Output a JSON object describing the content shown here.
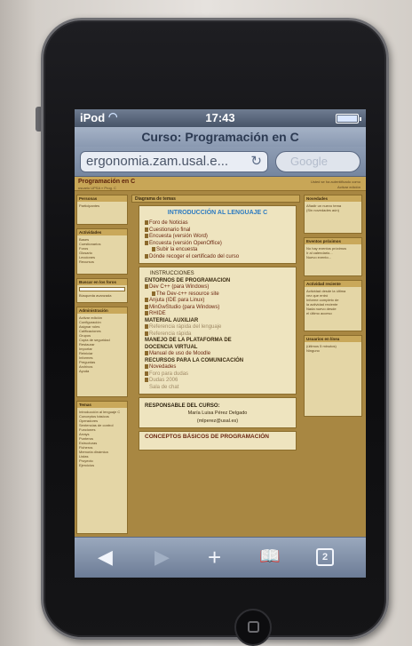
{
  "status": {
    "carrier": "iPod",
    "time": "17:43"
  },
  "browser": {
    "title": "Curso: Programación en C",
    "url": "ergonomia.zam.usal.e...",
    "search_placeholder": "Google"
  },
  "site": {
    "title": "Programación en C",
    "crumb": "usuario UPSA » Prog. C",
    "login": "Usted se ha autentificado como",
    "tools": "Activar edición"
  },
  "left_blocks": [
    {
      "heading": "Personas",
      "lines": [
        "Participantes"
      ]
    },
    {
      "heading": "Actividades",
      "lines": [
        "Bases",
        "Cuestionarios",
        "Foros",
        "Glosario",
        "Lecciones",
        "Recursos"
      ]
    },
    {
      "heading": "Buscar en los foros",
      "lines": [
        "Búsqueda avanzada"
      ]
    },
    {
      "heading": "Administración",
      "lines": [
        "Activar edición",
        "Configuración",
        "Asignar roles",
        "Calificaciones",
        "Grupos",
        "Copia de seguridad",
        "Restaurar",
        "Importar",
        "Reiniciar",
        "Informes",
        "Preguntas",
        "Archivos",
        "Ayuda"
      ]
    },
    {
      "heading": "Temas",
      "lines": [
        "Introducción al lenguaje C",
        "Conceptos básicos",
        "Operadores",
        "Sentencias de control",
        "Funciones",
        "Arrays",
        "Punteros",
        "Estructuras",
        "Ficheros",
        "Memoria dinámica",
        "Listas",
        "Proyecto",
        "Ejercicios"
      ]
    }
  ],
  "right_blocks": [
    {
      "heading": "Novedades",
      "lines": [
        "Añadir un nuevo tema",
        "(Sin novedades aún)"
      ]
    },
    {
      "heading": "Eventos próximos",
      "lines": [
        "No hay eventos próximos",
        "Ir al calendario...",
        "Nuevo evento..."
      ]
    },
    {
      "heading": "Actividad reciente",
      "lines": [
        "Actividad desde la última",
        "vez que entró",
        "Informe completo de",
        "la actividad reciente",
        "Nada nuevo desde",
        "el último acceso"
      ]
    },
    {
      "heading": "Usuarios en línea",
      "lines": [
        "(últimos 5 minutos)",
        "Ninguno"
      ]
    }
  ],
  "topics_heading": "Diagrama de temas",
  "intro": {
    "title": "INTRODUCCIÓN AL LENGUAJE C",
    "items": [
      "Foro de Noticias",
      "Cuestionario final",
      "Encuesta (versión Word)",
      "Encuesta (versión OpenOffice)",
      "Subir la encuesta",
      "Dónde recoger el certificado del curso"
    ]
  },
  "section2": {
    "instrucciones": "INSTRUCCIONES",
    "entornos": "ENTORNOS DE PROGRAMACION",
    "dev_cpp": "Dev C++ (para Windows)",
    "dev_cpp_resource": "The Dev-c++ resource site",
    "anjuta": "Anjuta (IDE para Linux)",
    "mingw": "MinGwStudio (para Windows)",
    "rhide": "RHIDE",
    "material": "MATERIAL AUXILIAR",
    "ref_lenguaje": "Referencia rápida del lenguaje",
    "ref_rapida": "Referencia rápida",
    "plataforma_1": "MANEJO DE LA PLATAFORMA DE",
    "plataforma_2": "DOCENCIA VIRTUAL",
    "moodle": "Manual de uso de Moodle",
    "recursos": "RECURSOS PARA LA COMUNICACIÓN",
    "novedades": "Novedades",
    "foro_dudas": "Foro para dudas",
    "dudas_2006": "Dudas 2006",
    "sala_chat": "Sala de chat"
  },
  "responsible": {
    "title": "RESPONSABLE DEL CURSO:",
    "name": "María Luisa Pérez Delgado",
    "email": "(mlperez@usal.es)"
  },
  "next_section": {
    "title": "CONCEPTOS BÁSICOS DE PROGRAMACIÓN"
  },
  "toolbar": {
    "pages_count": "2"
  }
}
